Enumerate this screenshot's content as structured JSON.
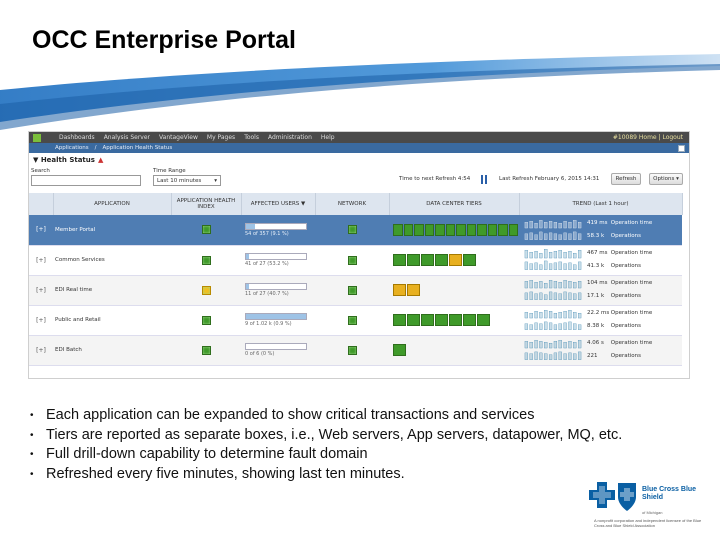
{
  "slide": {
    "title": "OCC Enterprise Portal",
    "bullets": [
      "Each application can be expanded to show critical transactions and services",
      "Tiers are reported as separate boxes, i.e., Web servers, App servers, datapower, MQ, etc.",
      "Full drill-down capability to determine fault domain",
      "Refreshed every five minutes, showing last ten minutes."
    ],
    "bullet_glyph": "•"
  },
  "portal": {
    "nav": [
      "Dashboards",
      "Analysis Server",
      "VantageView",
      "My Pages",
      "Tools",
      "Administration",
      "Help"
    ],
    "nav_right": "#10089 Home | Logout",
    "breadcrumb": [
      "Applications",
      "/",
      "Application Health Status"
    ],
    "page_title": "Health Status",
    "search_label": "Search",
    "time_range_label": "Time Range",
    "time_range_value": "Last 10 minutes",
    "next_refresh": "Time to next Refresh  4:54",
    "last_refresh": "Last Refresh  February 6, 2015 14:31",
    "refresh_button": "Refresh",
    "options_button": "Options ▾",
    "columns": [
      "APPLICATION",
      "APPLICATION HEALTH INDEX",
      "AFFECTED USERS ▼",
      "NETWORK",
      "DATA CENTER TIERS",
      "TREND (Last 1 hour)"
    ],
    "rows": [
      {
        "expander": "[+]",
        "name": "Member Portal",
        "health": "ok",
        "users_fraction": 0.15,
        "users_text": "54 of 357 (9.1 %)",
        "network": "ok",
        "tiers": [
          "ok",
          "ok",
          "ok",
          "ok",
          "ok",
          "ok",
          "ok",
          "ok",
          "ok",
          "ok",
          "ok",
          "ok"
        ],
        "trend_top": "419 ms",
        "trend_top_label": "Operation time",
        "trend_bottom": "58.3 k",
        "trend_bottom_label": "Operations",
        "selected": true
      },
      {
        "expander": "[+]",
        "name": "Common Services",
        "health": "ok",
        "users_fraction": 0.05,
        "users_text": "41 of 27 (53.2 %)",
        "network": "ok",
        "tiers": [
          "ok",
          "ok",
          "ok",
          "ok",
          "warn",
          "ok"
        ],
        "trend_top": "467 ms",
        "trend_top_label": "Operation time",
        "trend_bottom": "41.3 k",
        "trend_bottom_label": "Operations",
        "selected": false
      },
      {
        "expander": "[+]",
        "name": "EDI Real time",
        "health": "warn",
        "users_fraction": 0.05,
        "users_text": "11 of 27 (40.7 %)",
        "network": "ok",
        "tiers": [
          "warn",
          "warn"
        ],
        "trend_top": "104 ms",
        "trend_top_label": "Operation time",
        "trend_bottom": "17.1 k",
        "trend_bottom_label": "Operations",
        "selected": false
      },
      {
        "expander": "[+]",
        "name": "Public and Retail",
        "health": "ok",
        "users_fraction": 1.0,
        "users_text": "9 of 1.02 k (0.9 %)",
        "network": "ok",
        "tiers": [
          "ok",
          "ok",
          "ok",
          "ok",
          "ok",
          "ok",
          "ok"
        ],
        "trend_top": "22.2 ms",
        "trend_top_label": "Operation time",
        "trend_bottom": "8.38 k",
        "trend_bottom_label": "Operations",
        "selected": false
      },
      {
        "expander": "[+]",
        "name": "EDI Batch",
        "health": "ok",
        "users_fraction": 0.0,
        "users_text": "0 of 6 (0 %)",
        "network": "ok",
        "tiers": [
          "ok"
        ],
        "trend_top": "4.06 s",
        "trend_top_label": "Operation time",
        "trend_bottom": "221",
        "trend_bottom_label": "Operations",
        "selected": false
      }
    ]
  },
  "branding": {
    "logo_name": "Blue Cross Blue Shield",
    "logo_sub": "of Michigan",
    "footer": "A nonprofit corporation and independent licensee of the Blue Cross and Blue Shield Association"
  },
  "colors": {
    "swoosh": "#2b7bc6",
    "ok": "#3f9a2a",
    "warn": "#f0c020",
    "selected_row": "#4f7db3",
    "brand_blue": "#0a5fa3"
  }
}
